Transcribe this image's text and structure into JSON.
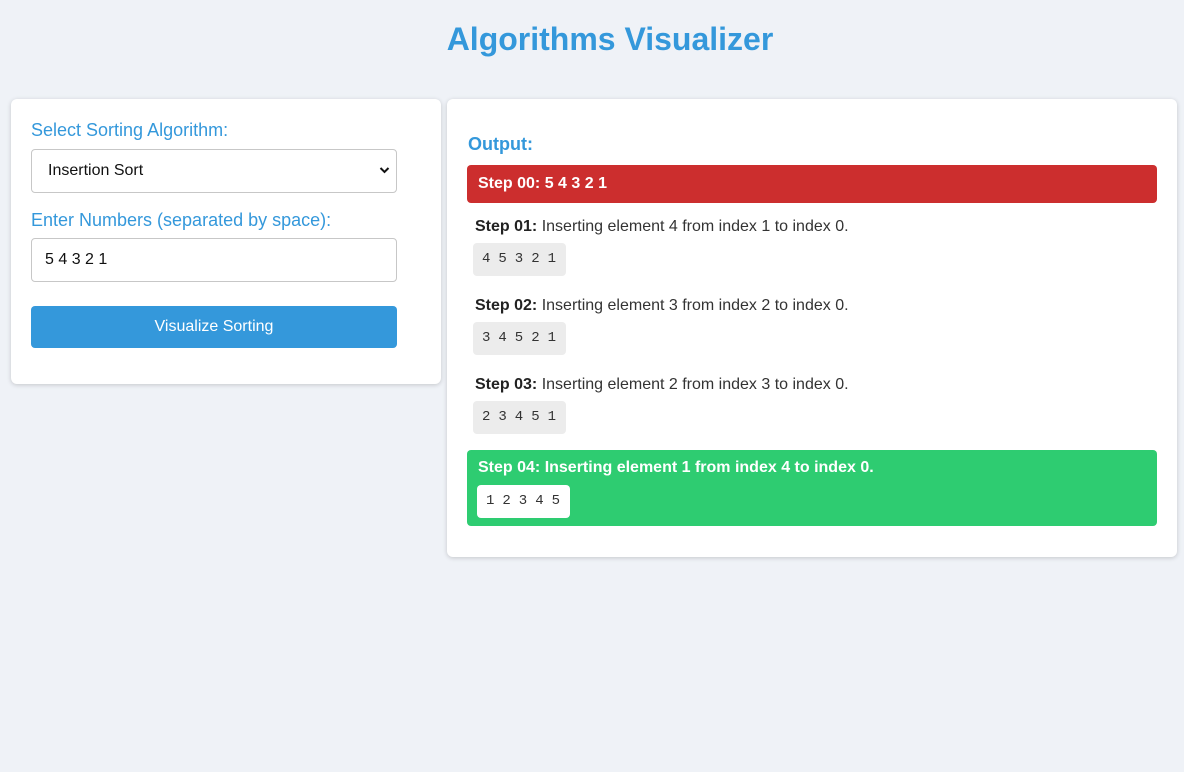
{
  "title": "Algorithms Visualizer",
  "controls": {
    "algorithm_label": "Select Sorting Algorithm:",
    "algorithm_selected": "Insertion Sort",
    "numbers_label": "Enter Numbers (separated by space):",
    "numbers_value": "5 4 3 2 1",
    "button_label": "Visualize Sorting"
  },
  "output": {
    "label": "Output:",
    "initial_step": "Step 00: 5 4 3 2 1",
    "steps": [
      {
        "label": "Step 01:",
        "description": "Inserting element 4 from index 1 to index 0.",
        "array": "4 5 3 2 1"
      },
      {
        "label": "Step 02:",
        "description": "Inserting element 3 from index 2 to index 0.",
        "array": "3 4 5 2 1"
      },
      {
        "label": "Step 03:",
        "description": "Inserting element 2 from index 3 to index 0.",
        "array": "2 3 4 5 1"
      }
    ],
    "final_step": {
      "text": "Step 04: Inserting element 1 from index 4 to index 0.",
      "array": "1 2 3 4 5"
    }
  },
  "colors": {
    "accent": "#3498db",
    "initial_step_bg": "#cc2e2e",
    "final_step_bg": "#2ecc71",
    "page_bg": "#eff2f7"
  }
}
